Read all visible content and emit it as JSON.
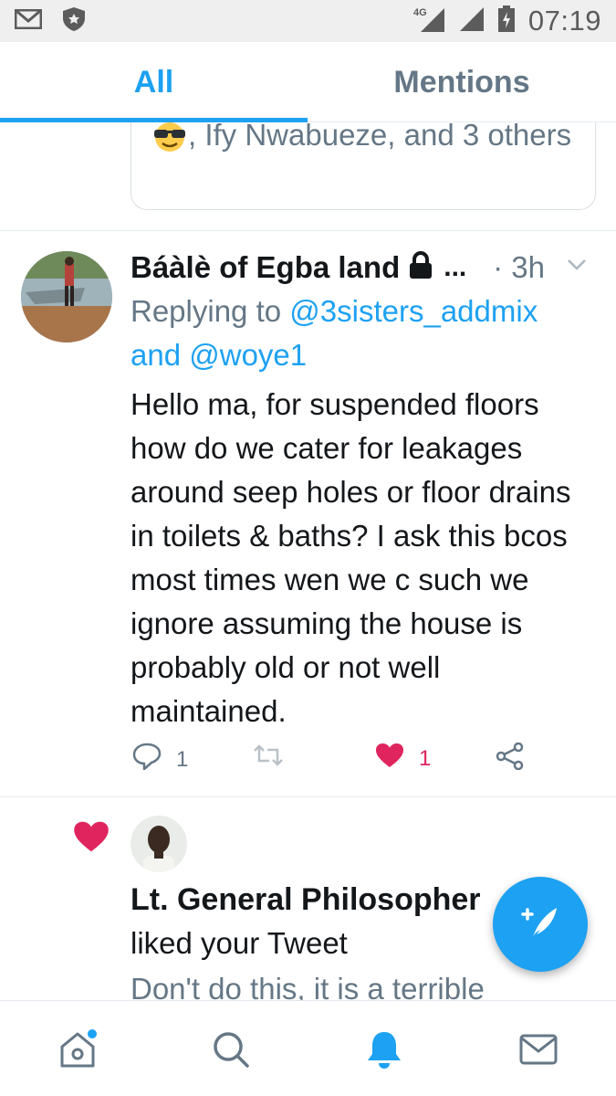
{
  "status_bar": {
    "time": "07:19",
    "network": "4G",
    "icons": [
      "gmail-icon",
      "shield-icon",
      "signal-icon",
      "battery-icon"
    ]
  },
  "tabs": [
    {
      "label": "All",
      "active": true
    },
    {
      "label": "Mentions",
      "active": false
    }
  ],
  "quote_card": {
    "text": ", Ify Nwabueze, and 3 others",
    "emoji": "sunglasses-emoji"
  },
  "tweet": {
    "author_name": "Báàlè of Egba land",
    "ellipsis": "...",
    "time": "· 3h",
    "reply_prefix": "Replying to",
    "reply_handle_1": "@3sisters_addmix",
    "reply_and": "and",
    "reply_handle_2": "@woye1",
    "body": "Hello ma, for suspended floors how do we cater for leakages around seep holes or floor drains in toilets & baths? I ask this bcos most times wen we c such we ignore assuming the house is probably old or not well maintained.",
    "reply_count": "1",
    "like_count": "1"
  },
  "notification": {
    "name": "Lt. General Philosopher",
    "action": "liked your Tweet",
    "preview": "Don't do this, it is a terrible"
  },
  "colors": {
    "accent": "#1da1f2",
    "like": "#e0245e",
    "secondary_text": "#657786"
  },
  "bottom_nav": [
    "home-icon",
    "search-icon",
    "notifications-icon",
    "messages-icon"
  ]
}
